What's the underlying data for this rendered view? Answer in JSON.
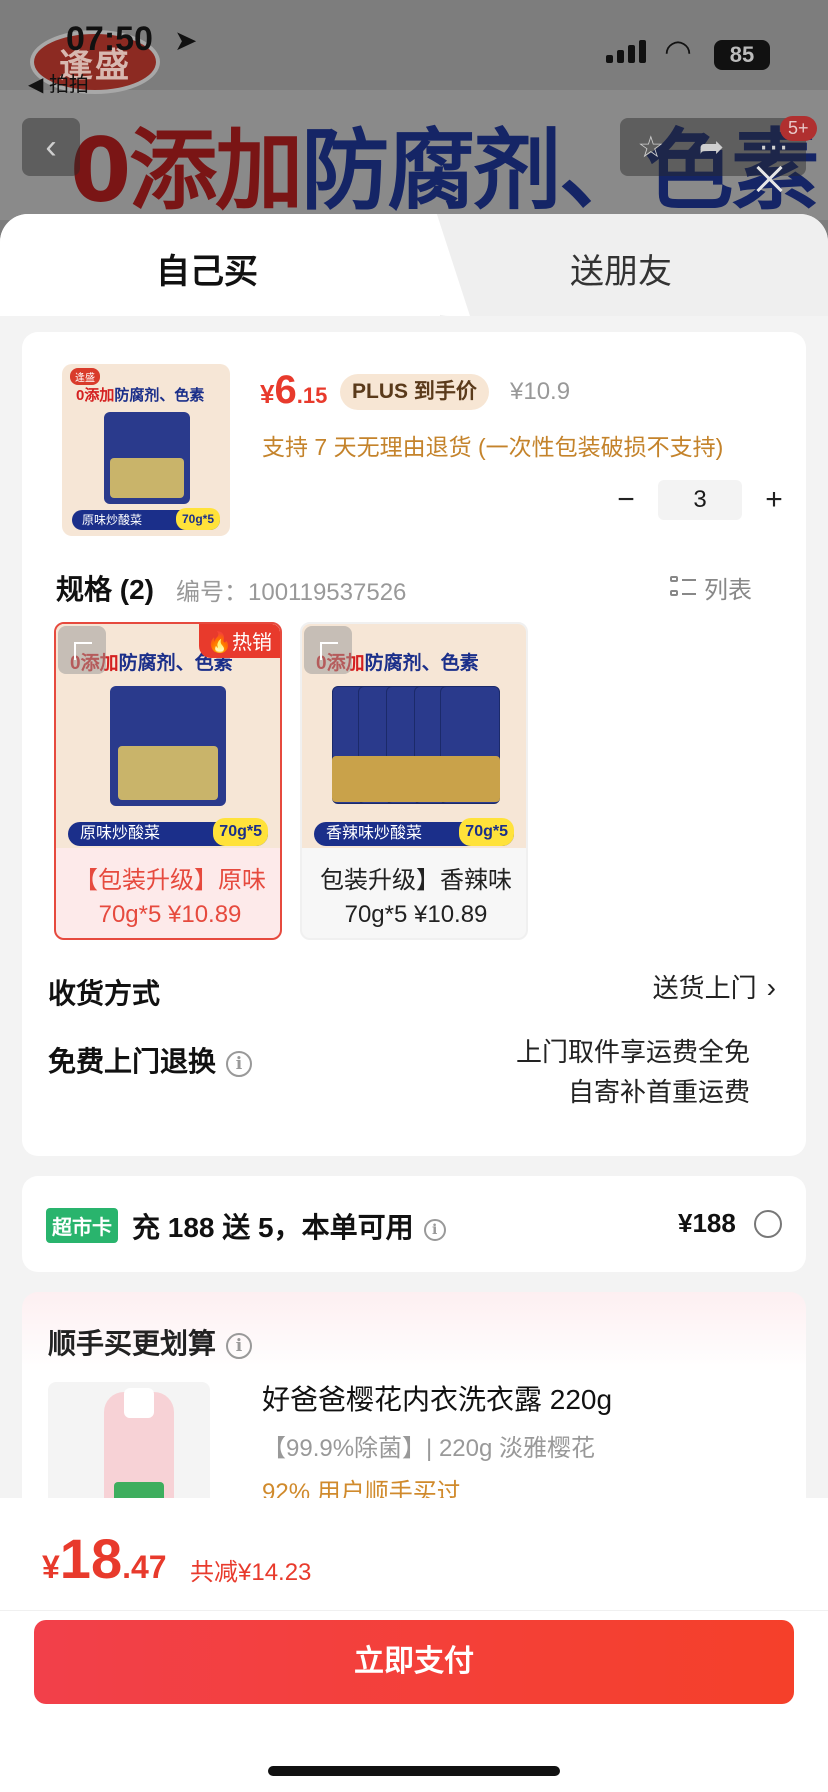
{
  "status_bar": {
    "time": "07:50",
    "back_app": "◀ 拍拍",
    "battery": "85"
  },
  "background": {
    "logo_text": "逢盛",
    "headline_red": "0添加",
    "headline_blue": "防腐剂、色素",
    "cart_badge": "5+"
  },
  "tabs": [
    {
      "label": "自己买",
      "active": true
    },
    {
      "label": "送朋友",
      "active": false
    }
  ],
  "product": {
    "thumb_title_red": "0添加",
    "thumb_title_blue": "防腐剂、色素",
    "thumb_band": "原味炒酸菜",
    "thumb_weight": "70g*5",
    "price_symbol": "¥",
    "price_int": "6",
    "price_dec": ".15",
    "plus_label": "PLUS 到手价",
    "original_price": "¥10.9",
    "return_note": "支持 7 天无理由退货 (一次性包装破损不支持)",
    "quantity": "3",
    "minus": "−",
    "plus": "+"
  },
  "spec": {
    "title": "规格 (2)",
    "code": "编号：100119537526",
    "list_toggle": "列表",
    "variants": [
      {
        "title_red": "0添加",
        "title_blue": "防腐剂、色素",
        "band": "原味炒酸菜",
        "weight": "70g*5",
        "hot": "🔥热销",
        "label": "【包装升级】原味 70g*5 ¥10.89",
        "selected": true
      },
      {
        "title_red": "0添加",
        "title_blue": "防腐剂、色素",
        "band": "香辣味炒酸菜",
        "weight": "70g*5",
        "label": "包装升级】香辣味 70g*5 ¥10.89",
        "selected": false
      }
    ]
  },
  "delivery": {
    "label": "收货方式",
    "value": "送货上门"
  },
  "returns": {
    "label": "免费上门退换",
    "line1": "上门取件享运费全免",
    "line2": "自寄补首重运费"
  },
  "supermarket": {
    "badge": "超市卡",
    "text": "充 188 送 5，本单可用",
    "price": "¥188"
  },
  "upsell": {
    "title": "顺手买更划算",
    "item_name": "好爸爸樱花内衣洗衣露 220g",
    "item_desc": "【99.9%除菌】| 220g 淡雅樱花",
    "item_social": "92% 用户顺手买过"
  },
  "footer": {
    "total_symbol": "¥",
    "total_int": "18",
    "total_dec": ".47",
    "discount": "共减¥14.23",
    "pay_label": "立即支付"
  },
  "colors": {
    "accent_red": "#e83a2c",
    "plus_bg": "#f7e6d4",
    "super_green": "#29b46d",
    "return_orange": "#c4832b"
  }
}
